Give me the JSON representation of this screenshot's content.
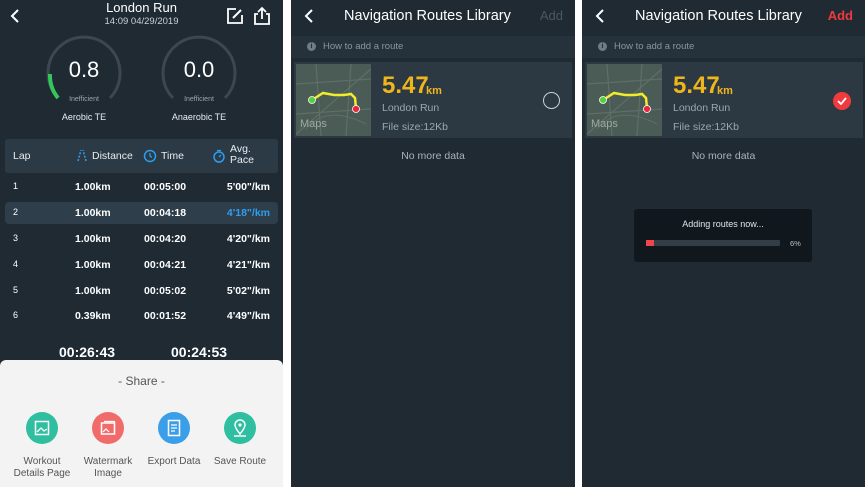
{
  "workout": {
    "title": "London Run",
    "date": "14:09 04/29/2019",
    "gauges": [
      {
        "value": "0.8",
        "rating": "Inefficient",
        "label": "Aerobic TE",
        "level": 0.27
      },
      {
        "value": "0.0",
        "rating": "Inefficient",
        "label": "Anaerobic TE",
        "level": 0.0
      }
    ],
    "columns": {
      "lap": "Lap",
      "distance": "Distance",
      "time": "Time",
      "pace": "Avg. Pace"
    },
    "laps": [
      {
        "lap": "1",
        "distance": "1.00km",
        "time": "00:05:00",
        "pace": "5'00\"/km"
      },
      {
        "lap": "2",
        "distance": "1.00km",
        "time": "00:04:18",
        "pace": "4'18\"/km"
      },
      {
        "lap": "3",
        "distance": "1.00km",
        "time": "00:04:20",
        "pace": "4'20\"/km"
      },
      {
        "lap": "4",
        "distance": "1.00km",
        "time": "00:04:21",
        "pace": "4'21\"/km"
      },
      {
        "lap": "5",
        "distance": "1.00km",
        "time": "00:05:02",
        "pace": "5'02\"/km"
      },
      {
        "lap": "6",
        "distance": "0.39km",
        "time": "00:01:52",
        "pace": "4'49\"/km"
      }
    ],
    "totals": [
      "00:26:43",
      "00:24:53"
    ],
    "share": {
      "title": "- Share -",
      "options": [
        {
          "label": "Workout Details Page",
          "icon": "image-icon",
          "color": "#2fbfa0"
        },
        {
          "label": "Watermark Image",
          "icon": "watermark-icon",
          "color": "#f26b6b"
        },
        {
          "label": "Export Data",
          "icon": "document-icon",
          "color": "#3a9ee8"
        },
        {
          "label": "Save Route",
          "icon": "location-pin-icon",
          "color": "#2fbfa0"
        }
      ]
    }
  },
  "library": {
    "title": "Navigation Routes Library",
    "add_label": "Add",
    "hint": "How to add a route",
    "route": {
      "distance": "5.47",
      "unit": "km",
      "name": "London Run",
      "size": "File size:12Kb",
      "map_label": "Maps"
    },
    "empty_text": "No more data"
  },
  "dialog": {
    "text": "Adding routes now...",
    "percent_label": "6%",
    "progress": 0.06
  },
  "colors": {
    "accent_blue": "#2e9df0",
    "distance_yellow": "#f1b51c",
    "add_red": "#f03a3e",
    "panel_bg": "#1f2a33"
  }
}
